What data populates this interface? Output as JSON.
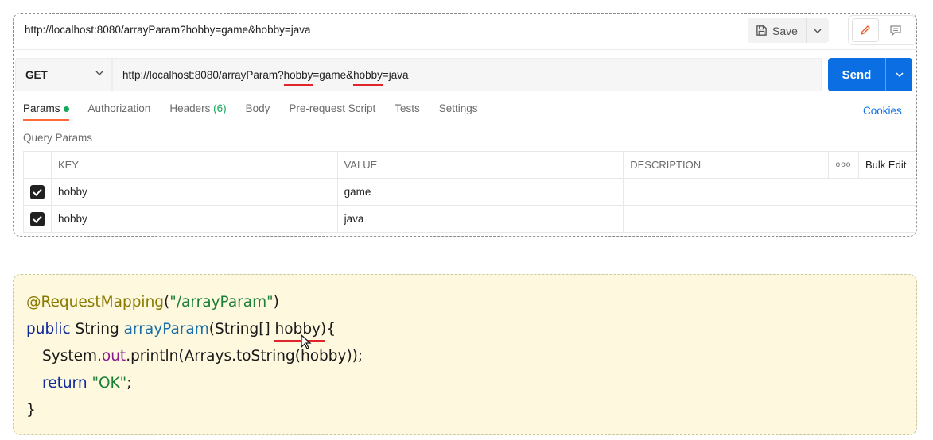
{
  "postman": {
    "request_title": "http://localhost:8080/arrayParam?hobby=game&hobby=java",
    "save_label": "Save",
    "method": "GET",
    "url_parts": {
      "prefix": "http://localhost:8080/arrayParam?",
      "key1": "hobby",
      "mid1": "=game&",
      "key2": "hobby",
      "suffix": "=java"
    },
    "send_label": "Send",
    "tabs": [
      {
        "label": "Params",
        "active": true
      },
      {
        "label": "Authorization"
      },
      {
        "label": "Headers",
        "count": "(6)"
      },
      {
        "label": "Body"
      },
      {
        "label": "Pre-request Script"
      },
      {
        "label": "Tests"
      },
      {
        "label": "Settings"
      }
    ],
    "cookies_label": "Cookies",
    "query_params_label": "Query Params",
    "table": {
      "headers": [
        "KEY",
        "VALUE",
        "DESCRIPTION"
      ],
      "more_icon": "ooo",
      "bulk_edit": "Bulk Edit",
      "rows": [
        {
          "checked": true,
          "key": "hobby",
          "value": "game",
          "description": ""
        },
        {
          "checked": true,
          "key": "hobby",
          "value": "java",
          "description": ""
        }
      ]
    },
    "accent_colors": {
      "send": "#0b6fe3",
      "active_tab": "#ff6c37",
      "indicator": "#14a85b"
    }
  },
  "code": {
    "line1": {
      "annotation": "@RequestMapping",
      "open": "(",
      "string": "\"/arrayParam\"",
      "close": ")"
    },
    "line2": {
      "kw": "public",
      "type": " String ",
      "method": "arrayParam",
      "params_pre": "(String[] ",
      "param": "hobby",
      "params_post": "){"
    },
    "line3": {
      "obj": "System.",
      "field": "out",
      "rest": ".println(Arrays.toString(hobby));"
    },
    "line4": {
      "kw": "return",
      "space": " ",
      "string": "\"OK\"",
      "semi": ";"
    },
    "line5": "}"
  }
}
